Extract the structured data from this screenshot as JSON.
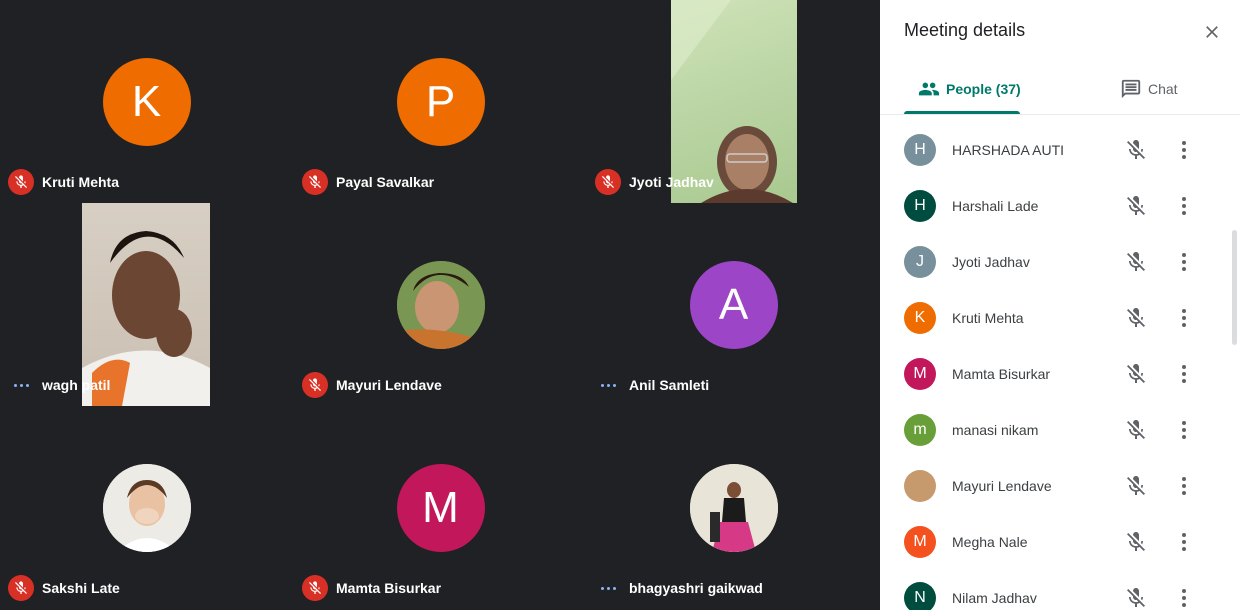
{
  "tiles": [
    {
      "name": "Kruti Mehta",
      "status": "muted",
      "avatar_letter": "K",
      "avatar_color": "#ef6c00"
    },
    {
      "name": "Payal Savalkar",
      "status": "muted",
      "avatar_letter": "P",
      "avatar_color": "#ef6c00"
    },
    {
      "name": "Jyoti Jadhav",
      "status": "muted",
      "avatar_letter": "",
      "avatar_color": ""
    },
    {
      "name": "wagh patil",
      "status": "speaking",
      "avatar_letter": "",
      "avatar_color": ""
    },
    {
      "name": "Mayuri Lendave",
      "status": "muted",
      "avatar_letter": "",
      "avatar_color": ""
    },
    {
      "name": "Anil Samleti",
      "status": "speaking",
      "avatar_letter": "A",
      "avatar_color": "#9c45c7"
    },
    {
      "name": "Sakshi Late",
      "status": "muted",
      "avatar_letter": "",
      "avatar_color": ""
    },
    {
      "name": "Mamta Bisurkar",
      "status": "muted",
      "avatar_letter": "M",
      "avatar_color": "#c2185b"
    },
    {
      "name": "bhagyashri gaikwad",
      "status": "speaking",
      "avatar_letter": "",
      "avatar_color": ""
    }
  ],
  "panel": {
    "title": "Meeting details",
    "tabs": {
      "people": "People (37)",
      "chat": "Chat"
    },
    "people": [
      {
        "name": "HARSHADA AUTI",
        "letter": "H",
        "color": "#78909c"
      },
      {
        "name": "Harshali Lade",
        "letter": "H",
        "color": "#004d40"
      },
      {
        "name": "Jyoti Jadhav",
        "letter": "J",
        "color": "#78909c"
      },
      {
        "name": "Kruti Mehta",
        "letter": "K",
        "color": "#ef6c00"
      },
      {
        "name": "Mamta Bisurkar",
        "letter": "M",
        "color": "#c2185b"
      },
      {
        "name": "manasi nikam",
        "letter": "m",
        "color": "#689f38"
      },
      {
        "name": "Mayuri Lendave",
        "letter": "",
        "color": "#c69a6d"
      },
      {
        "name": "Megha Nale",
        "letter": "M",
        "color": "#f4511e"
      },
      {
        "name": "Nilam Jadhav",
        "letter": "N",
        "color": "#004d40"
      }
    ]
  },
  "icons": {
    "mic_off": "mic-off-icon",
    "more": "more-vert-icon",
    "people": "people-icon",
    "chat": "chat-icon",
    "close": "close-icon"
  }
}
